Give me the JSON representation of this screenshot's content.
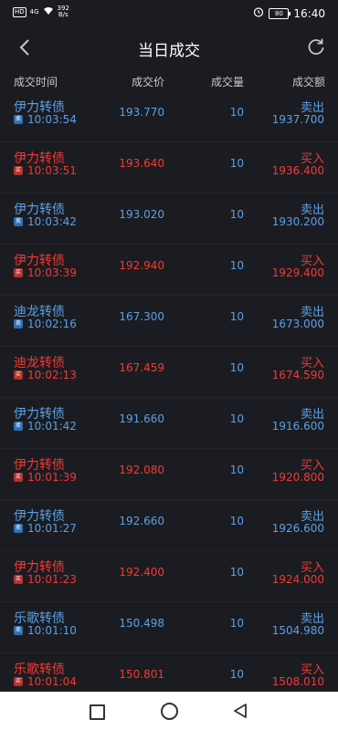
{
  "status_bar": {
    "hd": "HD",
    "signal": "4G",
    "speed": "392",
    "speed_unit": "B/s",
    "battery": "80",
    "time": "16:40"
  },
  "nav": {
    "title": "当日成交",
    "back_icon": "chevron-left-icon",
    "refresh_icon": "refresh-icon"
  },
  "table": {
    "headers": {
      "time": "成交时间",
      "price": "成交价",
      "volume": "成交量",
      "amount": "成交额"
    },
    "rows": [
      {
        "name": "伊力转债",
        "badge": "卖",
        "time": "10:03:54",
        "price": "193.770",
        "volume": "10",
        "direction": "卖出",
        "amount": "1937.700",
        "side": "sell"
      },
      {
        "name": "伊力转债",
        "badge": "买",
        "time": "10:03:51",
        "price": "193.640",
        "volume": "10",
        "direction": "买入",
        "amount": "1936.400",
        "side": "buy"
      },
      {
        "name": "伊力转债",
        "badge": "卖",
        "time": "10:03:42",
        "price": "193.020",
        "volume": "10",
        "direction": "卖出",
        "amount": "1930.200",
        "side": "sell"
      },
      {
        "name": "伊力转债",
        "badge": "买",
        "time": "10:03:39",
        "price": "192.940",
        "volume": "10",
        "direction": "买入",
        "amount": "1929.400",
        "side": "buy"
      },
      {
        "name": "迪龙转债",
        "badge": "卖",
        "time": "10:02:16",
        "price": "167.300",
        "volume": "10",
        "direction": "卖出",
        "amount": "1673.000",
        "side": "sell"
      },
      {
        "name": "迪龙转债",
        "badge": "买",
        "time": "10:02:13",
        "price": "167.459",
        "volume": "10",
        "direction": "买入",
        "amount": "1674.590",
        "side": "buy"
      },
      {
        "name": "伊力转债",
        "badge": "卖",
        "time": "10:01:42",
        "price": "191.660",
        "volume": "10",
        "direction": "卖出",
        "amount": "1916.600",
        "side": "sell"
      },
      {
        "name": "伊力转债",
        "badge": "买",
        "time": "10:01:39",
        "price": "192.080",
        "volume": "10",
        "direction": "买入",
        "amount": "1920.800",
        "side": "buy"
      },
      {
        "name": "伊力转债",
        "badge": "卖",
        "time": "10:01:27",
        "price": "192.660",
        "volume": "10",
        "direction": "卖出",
        "amount": "1926.600",
        "side": "sell"
      },
      {
        "name": "伊力转债",
        "badge": "买",
        "time": "10:01:23",
        "price": "192.400",
        "volume": "10",
        "direction": "买入",
        "amount": "1924.000",
        "side": "buy"
      },
      {
        "name": "乐歌转债",
        "badge": "卖",
        "time": "10:01:10",
        "price": "150.498",
        "volume": "10",
        "direction": "卖出",
        "amount": "1504.980",
        "side": "sell"
      },
      {
        "name": "乐歌转债",
        "badge": "买",
        "time": "10:01:04",
        "price": "150.801",
        "volume": "10",
        "direction": "买入",
        "amount": "1508.010",
        "side": "buy"
      }
    ]
  },
  "colors": {
    "background": "#1b1c21",
    "sell": "#5aa0e6",
    "buy": "#f23a34"
  }
}
